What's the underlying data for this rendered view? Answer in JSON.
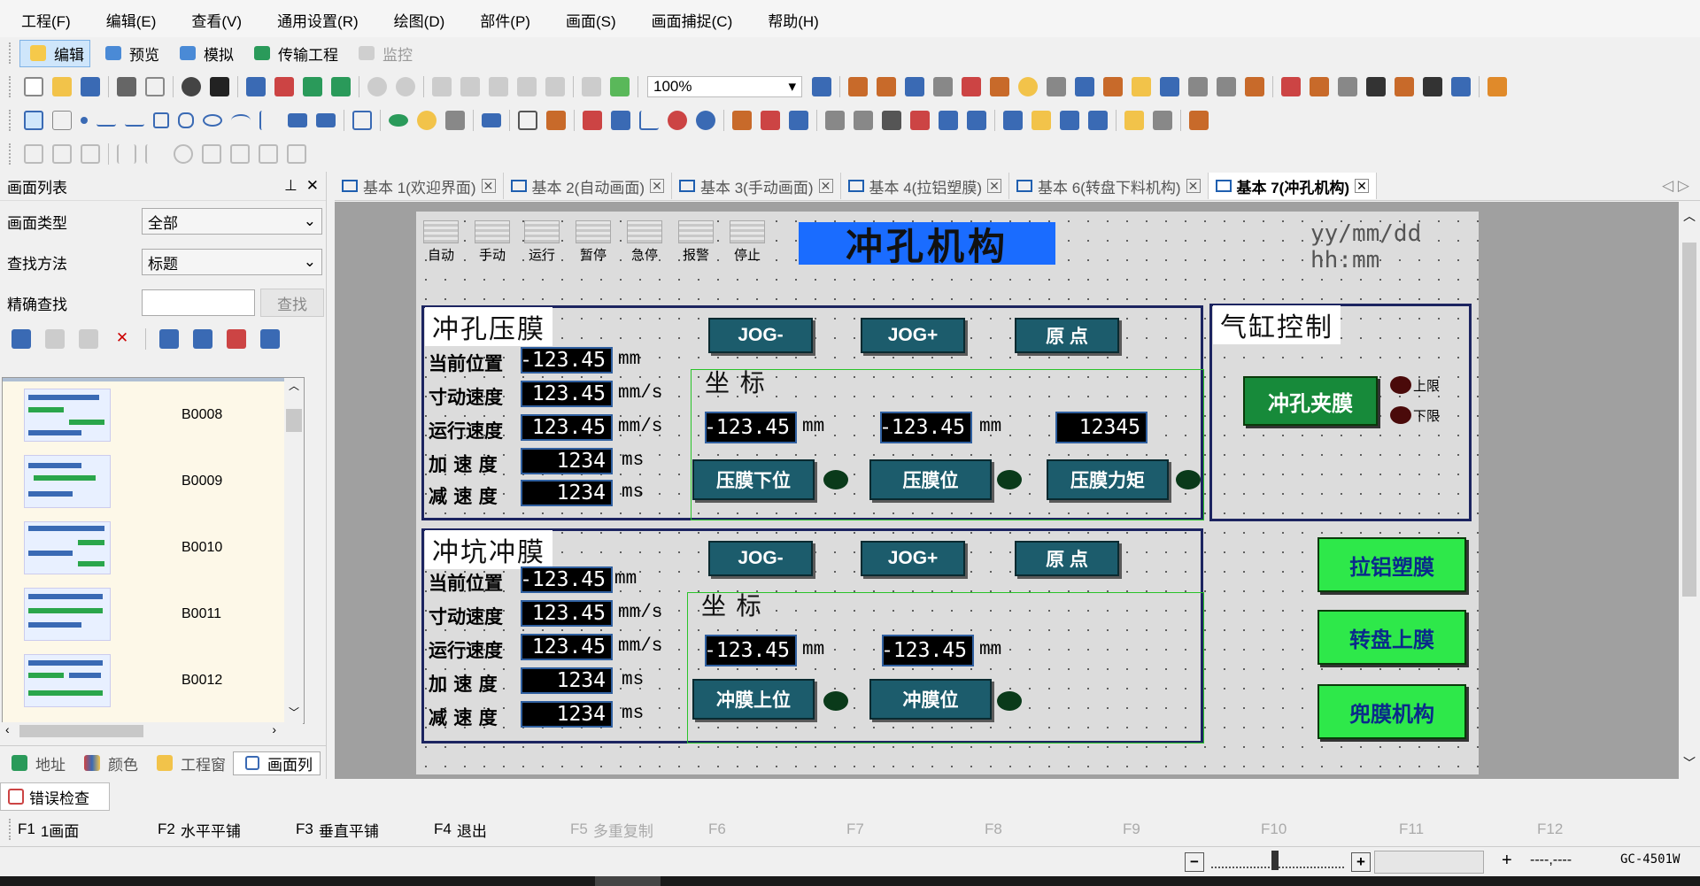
{
  "menu": [
    "工程(F)",
    "编辑(E)",
    "查看(V)",
    "通用设置(R)",
    "绘图(D)",
    "部件(P)",
    "画面(S)",
    "画面捕捉(C)",
    "帮助(H)"
  ],
  "modes": [
    "编辑",
    "预览",
    "模拟",
    "传输工程",
    "监控"
  ],
  "zoom": "100%",
  "left_panel": {
    "title": "画面列表",
    "type_label": "画面类型",
    "type_value": "全部",
    "method_label": "查找方法",
    "method_value": "标题",
    "exact_label": "精确查找",
    "search_button": "查找",
    "items": [
      "B0008",
      "B0009",
      "B0010",
      "B0011",
      "B0012"
    ]
  },
  "bottom_tabs": [
    "地址",
    "颜色",
    "工程窗",
    "画面列"
  ],
  "error_tab": "错误检查",
  "tabs": [
    "基本 1(欢迎界面)",
    "基本 2(自动画面)",
    "基本 3(手动画面)",
    "基本 4(拉铝塑膜)",
    "基本 6(转盘下料机构)",
    "基本 7(冲孔机构)"
  ],
  "screen": {
    "status_icons": [
      "自动",
      "手动",
      "运行",
      "暂停",
      "急停",
      "报警",
      "停止"
    ],
    "title": "冲孔机构",
    "datetime": "yy/mm/dd hh:mm",
    "panel1": {
      "title": "冲孔压膜",
      "labels": [
        "当前位置",
        "寸动速度",
        "运行速度",
        "加 速 度",
        "减 速 度"
      ],
      "values": [
        "-123.45",
        "123.45",
        "123.45",
        "1234",
        "1234"
      ],
      "units": [
        "mm",
        "mm/s",
        "mm/s",
        "ms",
        "ms"
      ],
      "jog_minus": "JOG-",
      "jog_plus": "JOG+",
      "origin": "原 点",
      "coord_title": "坐 标",
      "coord_values": [
        "-123.45",
        "-123.45",
        "12345"
      ],
      "coord_units": [
        "mm",
        "mm"
      ],
      "buttons": [
        "压膜下位",
        "压膜位",
        "压膜力矩"
      ]
    },
    "panel2": {
      "title": "冲坑冲膜",
      "labels": [
        "当前位置",
        "寸动速度",
        "运行速度",
        "加 速 度",
        "减 速 度"
      ],
      "values": [
        "-123.45",
        "123.45",
        "123.45",
        "1234",
        "1234"
      ],
      "units": [
        "mm",
        "mm/s",
        "mm/s",
        "ms",
        "ms"
      ],
      "jog_minus": "JOG-",
      "jog_plus": "JOG+",
      "origin": "原 点",
      "coord_title": "坐 标",
      "coord_values": [
        "-123.45",
        "-123.45"
      ],
      "coord_units": [
        "mm",
        "mm"
      ],
      "buttons": [
        "冲膜上位",
        "冲膜位"
      ]
    },
    "cylinder": {
      "title": "气缸控制",
      "button": "冲孔夹膜",
      "upper": "上限",
      "lower": "下限"
    },
    "nav_buttons": [
      "拉铝塑膜",
      "转盘上膜",
      "兜膜机构"
    ]
  },
  "fkeys": [
    {
      "key": "F1",
      "label": "1画面"
    },
    {
      "key": "F2",
      "label": "水平平铺"
    },
    {
      "key": "F3",
      "label": "垂直平铺"
    },
    {
      "key": "F4",
      "label": "退出"
    },
    {
      "key": "F5",
      "label": "多重复制"
    },
    {
      "key": "F6",
      "label": ""
    },
    {
      "key": "F7",
      "label": ""
    },
    {
      "key": "F8",
      "label": ""
    },
    {
      "key": "F9",
      "label": ""
    },
    {
      "key": "F10",
      "label": ""
    },
    {
      "key": "F11",
      "label": ""
    },
    {
      "key": "F12",
      "label": ""
    }
  ],
  "status": {
    "coords": "----,----",
    "model": "GC-4501W"
  },
  "colors": {
    "hmi_button": "#1c5c6c",
    "nav_button": "#2ee84a",
    "panel_border": "#1c2460",
    "title_bg": "#1a6cff"
  }
}
